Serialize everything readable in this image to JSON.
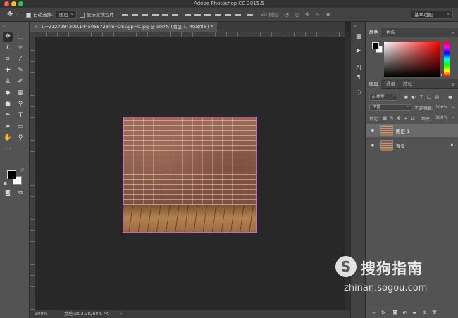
{
  "window": {
    "title": "Adobe Photoshop CC 2015.5",
    "traffic_colors": [
      "#ff5f57",
      "#ffbd2e",
      "#28c840"
    ]
  },
  "options_bar": {
    "move_icon": "move-arrows-icon",
    "auto_select_label": "自动选择:",
    "auto_select_value": "图层",
    "show_transform_label": "显示变换控件",
    "mode_3d_label": "3D 模式:",
    "workspace_value": "基本功能"
  },
  "document": {
    "tab_title": "u=2127984300,1445055728fm=26&gp=0.jpg @ 100% (图层 1, RGB/8#) *",
    "close_glyph": "×"
  },
  "status": {
    "zoom": "100%",
    "doc_size": "文档:302.3K/604.7K",
    "arrow": "›"
  },
  "tools": [
    "move",
    "marquee",
    "lasso",
    "magic-wand",
    "crop",
    "eyedropper",
    "healing",
    "brush",
    "stamp",
    "history-brush",
    "eraser",
    "gradient",
    "blur",
    "dodge",
    "pen",
    "type",
    "path-select",
    "rectangle",
    "hand",
    "zoom",
    "more"
  ],
  "color_panel": {
    "tabs": [
      "颜色",
      "色板"
    ],
    "foreground": "#000000",
    "background": "#ffffff"
  },
  "layers_panel": {
    "tabs": [
      "图层",
      "通道",
      "路径"
    ],
    "filter_kind": "ρ 类型",
    "blend_mode": "正常",
    "opacity_label": "不透明度:",
    "opacity_value": "100%",
    "lock_label": "锁定:",
    "fill_label": "填充:",
    "fill_value": "100%",
    "layers": [
      {
        "name": "图层 1",
        "selected": true,
        "locked": false
      },
      {
        "name": "背景",
        "selected": false,
        "locked": true
      }
    ],
    "footer_fx": "fx"
  },
  "watermark": {
    "name": "搜狗指南",
    "url": "zhinan.sogou.com",
    "logo_letter": "S"
  }
}
